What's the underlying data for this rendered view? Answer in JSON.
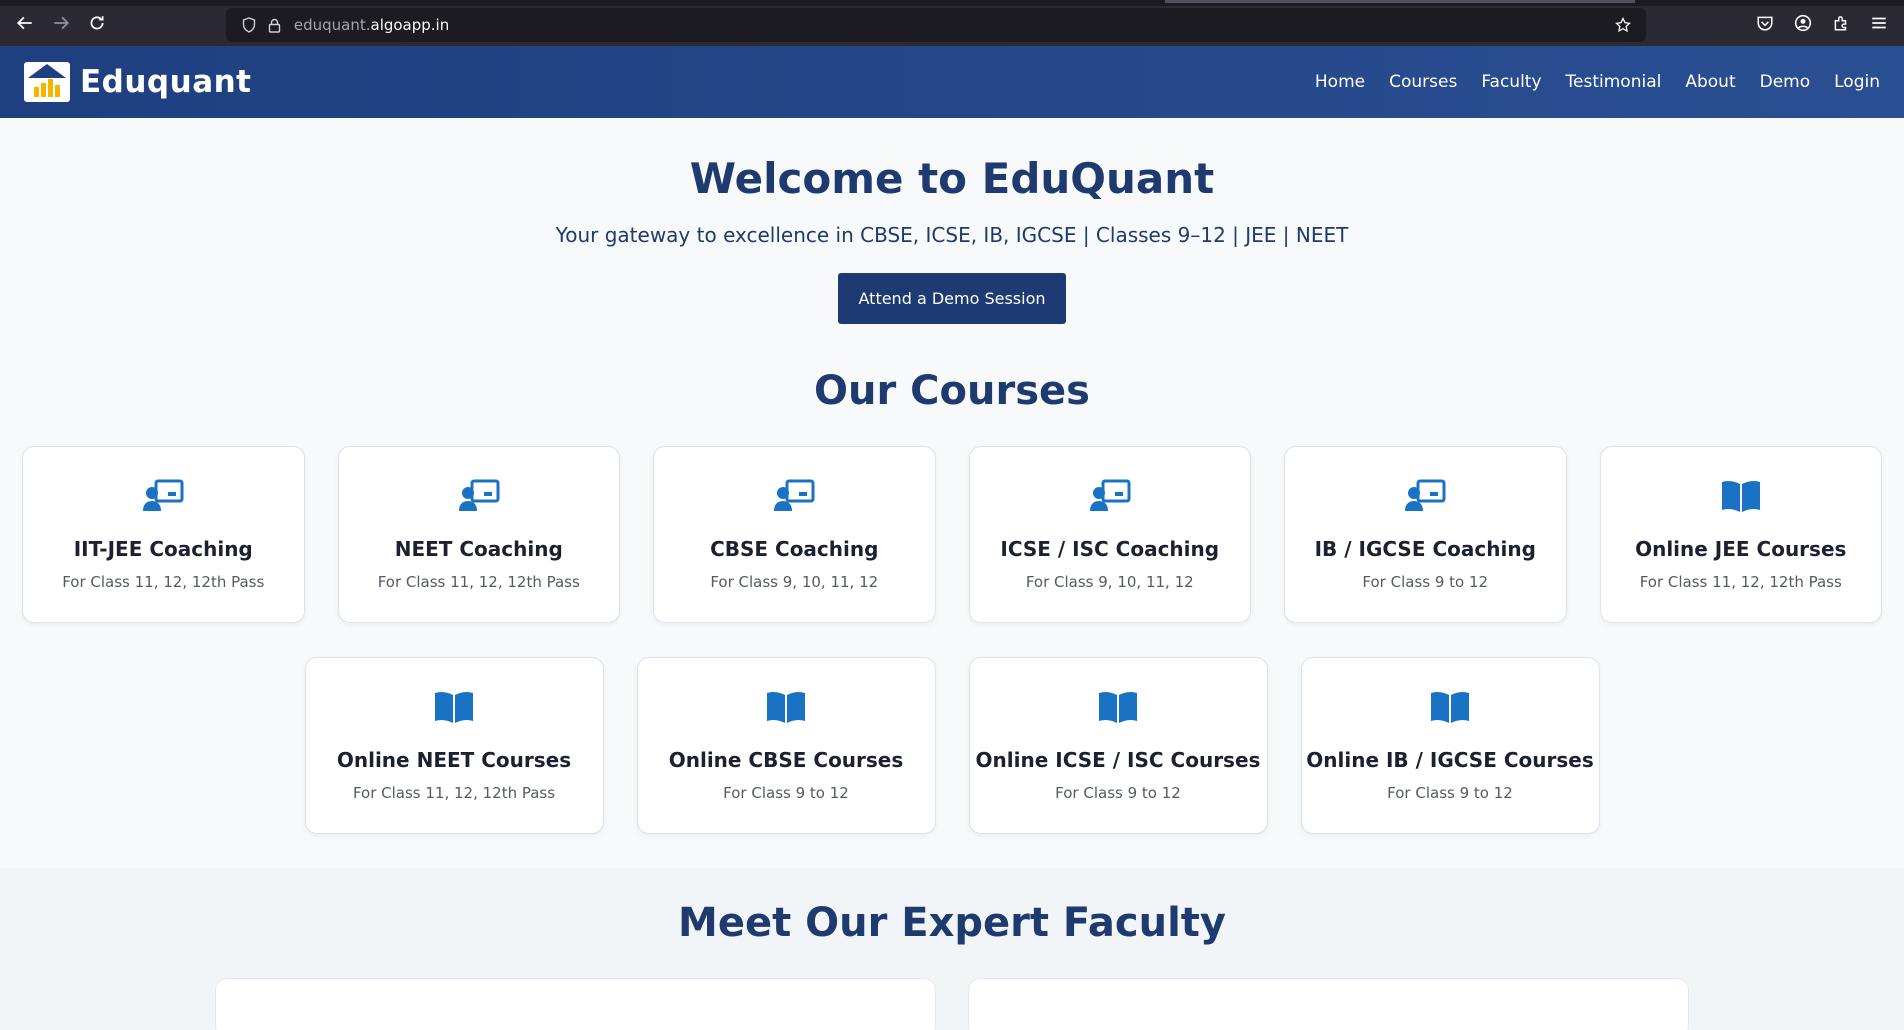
{
  "browser": {
    "url_prefix": "eduquant.",
    "url_domain": "algoapp.in"
  },
  "site": {
    "brand": "Eduquant",
    "nav": [
      {
        "label": "Home"
      },
      {
        "label": "Courses"
      },
      {
        "label": "Faculty"
      },
      {
        "label": "Testimonial"
      },
      {
        "label": "About"
      },
      {
        "label": "Demo"
      },
      {
        "label": "Login"
      }
    ]
  },
  "hero": {
    "title": "Welcome to EduQuant",
    "subtitle": "Your gateway to excellence in CBSE, ICSE, IB, IGCSE | Classes 9–12 | JEE | NEET",
    "cta": "Attend a Demo Session"
  },
  "courses": {
    "title": "Our Courses",
    "row1": [
      {
        "icon": "teacher-icon",
        "title": "IIT-JEE Coaching",
        "sub": "For Class 11, 12, 12th Pass"
      },
      {
        "icon": "teacher-icon",
        "title": "NEET Coaching",
        "sub": "For Class 11, 12, 12th Pass"
      },
      {
        "icon": "teacher-icon",
        "title": "CBSE Coaching",
        "sub": "For Class 9, 10, 11, 12"
      },
      {
        "icon": "teacher-icon",
        "title": "ICSE / ISC Coaching",
        "sub": "For Class 9, 10, 11, 12"
      },
      {
        "icon": "teacher-icon",
        "title": "IB / IGCSE Coaching",
        "sub": "For Class 9 to 12"
      },
      {
        "icon": "book-icon",
        "title": "Online JEE Courses",
        "sub": "For Class 11, 12, 12th Pass"
      }
    ],
    "row2": [
      {
        "icon": "book-icon",
        "title": "Online NEET Courses",
        "sub": "For Class 11, 12, 12th Pass"
      },
      {
        "icon": "book-icon",
        "title": "Online CBSE Courses",
        "sub": "For Class 9 to 12"
      },
      {
        "icon": "book-icon",
        "title": "Online ICSE / ISC Courses",
        "sub": "For Class 9 to 12"
      },
      {
        "icon": "book-icon",
        "title": "Online IB / IGCSE Courses",
        "sub": "For Class 9 to 12"
      }
    ]
  },
  "faculty": {
    "title": "Meet Our Expert Faculty"
  },
  "colors": {
    "header": "#1e3f80",
    "accent_icon": "#1a72c4",
    "heading": "#1f3a6e",
    "logo_bars": "#f5b400"
  }
}
